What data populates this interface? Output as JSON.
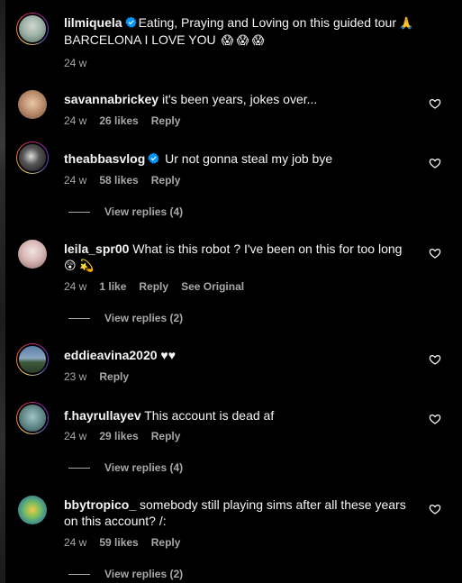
{
  "colors": {
    "background": "#000000",
    "text": "#f5f5f5",
    "secondary": "#a8a8a8",
    "verified": "#0095f6"
  },
  "post_caption": {
    "username": "lilmiquela",
    "verified": true,
    "text": "Eating, Praying and Loving on this guided tour",
    "emoji_after": "🙏",
    "line2": "BARCELONA I LOVE YOU",
    "emojis_line2": "😱 😱 😱",
    "time": "24 w"
  },
  "comments": [
    {
      "username": "savannabrickey",
      "text": "it's been years, jokes over...",
      "time": "24 w",
      "likes": "26 likes",
      "reply": "Reply"
    },
    {
      "username": "theabbasvlog",
      "verified": true,
      "text": "Ur not gonna steal my job bye",
      "time": "24 w",
      "likes": "58 likes",
      "reply": "Reply",
      "view_replies": "View replies (4)"
    },
    {
      "username": "leila_spr00",
      "text": "What is this robot ? I've been on this for too long",
      "emojis": "😲 💫",
      "time": "24 w",
      "likes": "1 like",
      "reply": "Reply",
      "see_original": "See Original",
      "view_replies": "View replies (2)"
    },
    {
      "username": "eddieavina2020",
      "text": "♥♥",
      "time": "23 w",
      "reply": "Reply"
    },
    {
      "username": "f.hayrullayev",
      "text": "This account is dead af",
      "time": "24 w",
      "likes": "29 likes",
      "reply": "Reply",
      "view_replies": "View replies (4)"
    },
    {
      "username": "bbytropico_",
      "text": "somebody still playing sims after all these years",
      "text_line2": "on this account? /:",
      "time": "24 w",
      "likes": "59 likes",
      "reply": "Reply",
      "view_replies": "View replies (2)"
    }
  ]
}
